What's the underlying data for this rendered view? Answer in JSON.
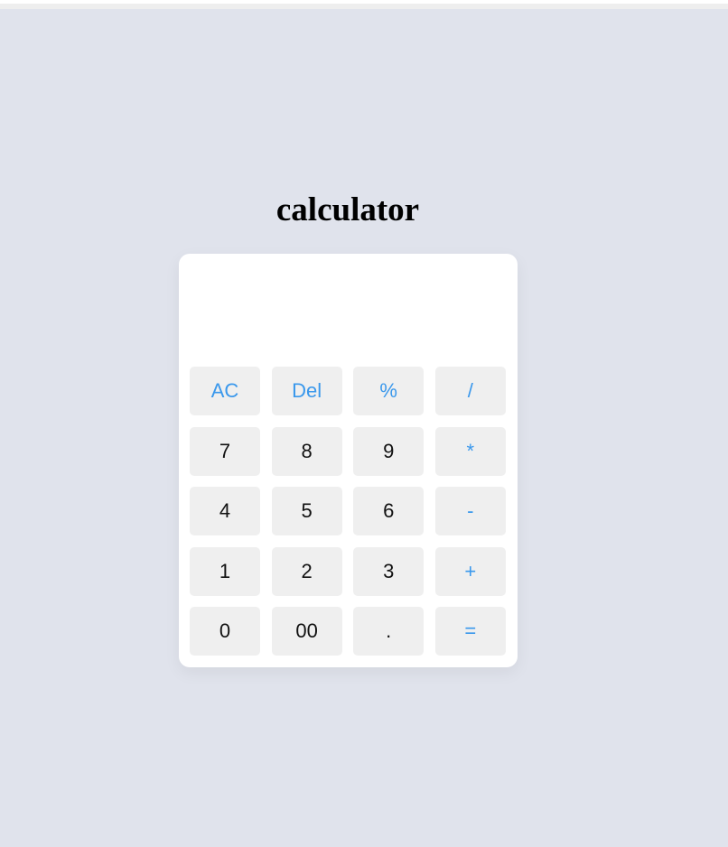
{
  "page": {
    "title": "calculator"
  },
  "display": {
    "value": ""
  },
  "keys": [
    {
      "label": "AC",
      "kind": "op",
      "name": "clear-button"
    },
    {
      "label": "Del",
      "kind": "op",
      "name": "delete-button"
    },
    {
      "label": "%",
      "kind": "op",
      "name": "percent-button"
    },
    {
      "label": "/",
      "kind": "op",
      "name": "divide-button"
    },
    {
      "label": "7",
      "kind": "num",
      "name": "digit-7-button"
    },
    {
      "label": "8",
      "kind": "num",
      "name": "digit-8-button"
    },
    {
      "label": "9",
      "kind": "num",
      "name": "digit-9-button"
    },
    {
      "label": "*",
      "kind": "op",
      "name": "multiply-button"
    },
    {
      "label": "4",
      "kind": "num",
      "name": "digit-4-button"
    },
    {
      "label": "5",
      "kind": "num",
      "name": "digit-5-button"
    },
    {
      "label": "6",
      "kind": "num",
      "name": "digit-6-button"
    },
    {
      "label": "-",
      "kind": "op",
      "name": "subtract-button"
    },
    {
      "label": "1",
      "kind": "num",
      "name": "digit-1-button"
    },
    {
      "label": "2",
      "kind": "num",
      "name": "digit-2-button"
    },
    {
      "label": "3",
      "kind": "num",
      "name": "digit-3-button"
    },
    {
      "label": "+",
      "kind": "op",
      "name": "add-button"
    },
    {
      "label": "0",
      "kind": "num",
      "name": "digit-0-button"
    },
    {
      "label": "00",
      "kind": "num",
      "name": "double-zero-button"
    },
    {
      "label": ".",
      "kind": "num",
      "name": "decimal-point-button"
    },
    {
      "label": "=",
      "kind": "op",
      "name": "equals-button"
    }
  ],
  "colors": {
    "background": "#e0e3ec",
    "card": "#ffffff",
    "key": "#efefef",
    "operator_text": "#3a98ec",
    "digit_text": "#111111"
  }
}
